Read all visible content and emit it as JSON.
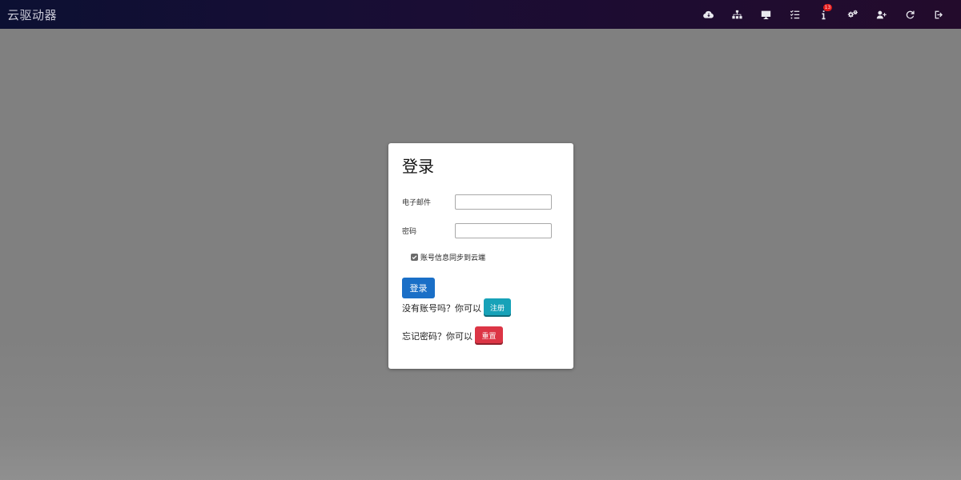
{
  "app": {
    "title": "云驱动器"
  },
  "navbar": {
    "icons": [
      {
        "name": "cloud-download-icon"
      },
      {
        "name": "network-icon"
      },
      {
        "name": "desktop-icon"
      },
      {
        "name": "tasks-icon"
      },
      {
        "name": "info-icon",
        "badge": "13"
      },
      {
        "name": "gears-icon"
      },
      {
        "name": "user-plus-icon"
      },
      {
        "name": "refresh-icon"
      },
      {
        "name": "sign-out-icon"
      }
    ],
    "colors": {
      "start": "#0c1033",
      "end": "#230b2c"
    }
  },
  "login": {
    "title": "登录",
    "email_label": "电子邮件",
    "email_value": "",
    "password_label": "密码",
    "password_value": "",
    "sync_label": "账号信息同步到云端",
    "sync_checked": true,
    "login_button": "登录",
    "register_prompt": "没有账号吗？你可以",
    "register_button": "注册",
    "reset_prompt": "忘记密码？你可以",
    "reset_button": "重置"
  },
  "colors": {
    "login": "#1a6fc7",
    "register": "#17a2b8",
    "reset": "#dc3545",
    "overlay": "#808080"
  }
}
